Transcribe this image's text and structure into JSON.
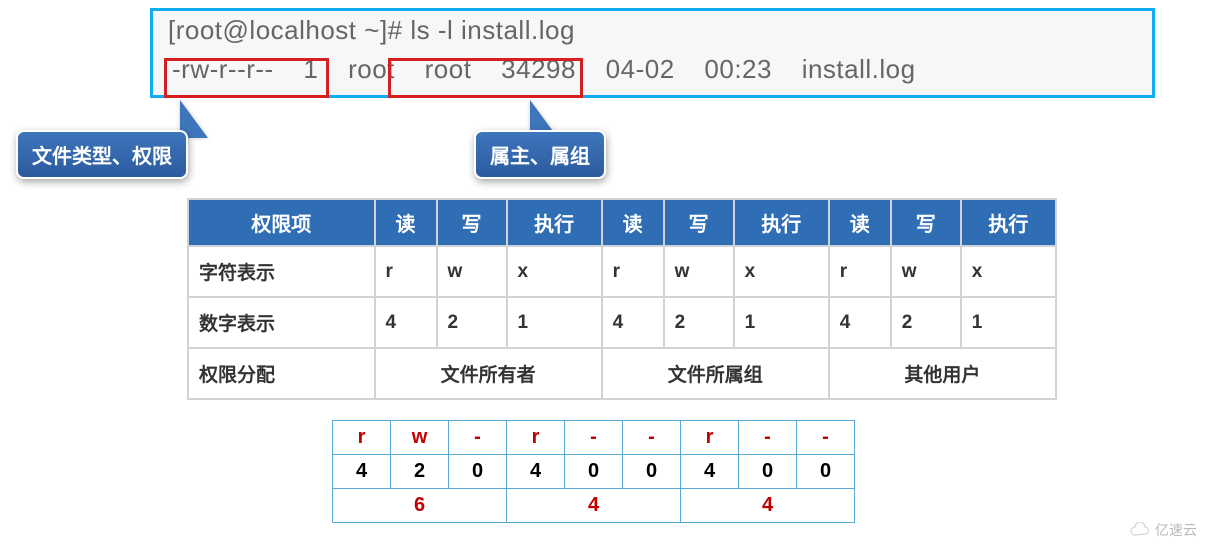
{
  "terminal": {
    "command": "[root@localhost ~]# ls -l install.log",
    "output": "-rw-r--r--  1  root  root  34298  04-02  00:23  install.log"
  },
  "callouts": {
    "file_type_perm": "文件类型、权限",
    "owner_group": "属主、属组"
  },
  "perm_table": {
    "headers": [
      "权限项",
      "读",
      "写",
      "执行",
      "读",
      "写",
      "执行",
      "读",
      "写",
      "执行"
    ],
    "rows": {
      "char_repr": {
        "label": "字符表示",
        "values": [
          "r",
          "w",
          "x",
          "r",
          "w",
          "x",
          "r",
          "w",
          "x"
        ]
      },
      "num_repr": {
        "label": "数字表示",
        "values": [
          "4",
          "2",
          "1",
          "4",
          "2",
          "1",
          "4",
          "2",
          "1"
        ]
      },
      "alloc": {
        "label": "权限分配",
        "owner": "文件所有者",
        "group": "文件所属组",
        "other": "其他用户"
      }
    }
  },
  "num_table": {
    "row1": [
      "r",
      "w",
      "-",
      "r",
      "-",
      "-",
      "r",
      "-",
      "-"
    ],
    "row2": [
      "4",
      "2",
      "0",
      "4",
      "0",
      "0",
      "4",
      "0",
      "0"
    ],
    "row3": [
      "6",
      "4",
      "4"
    ]
  },
  "watermark": "亿速云",
  "chart_data": {
    "type": "table",
    "title": "Linux file permission numeric mapping",
    "legend": {
      "r": 4,
      "w": 2,
      "x": 1,
      "-": 0
    },
    "groups": [
      {
        "name": "owner",
        "symbols": [
          "r",
          "w",
          "-"
        ],
        "values": [
          4,
          2,
          0
        ],
        "sum": 6
      },
      {
        "name": "group",
        "symbols": [
          "r",
          "-",
          "-"
        ],
        "values": [
          4,
          0,
          0
        ],
        "sum": 4
      },
      {
        "name": "other",
        "symbols": [
          "r",
          "-",
          "-"
        ],
        "values": [
          4,
          0,
          0
        ],
        "sum": 4
      }
    ],
    "octal": "644"
  }
}
